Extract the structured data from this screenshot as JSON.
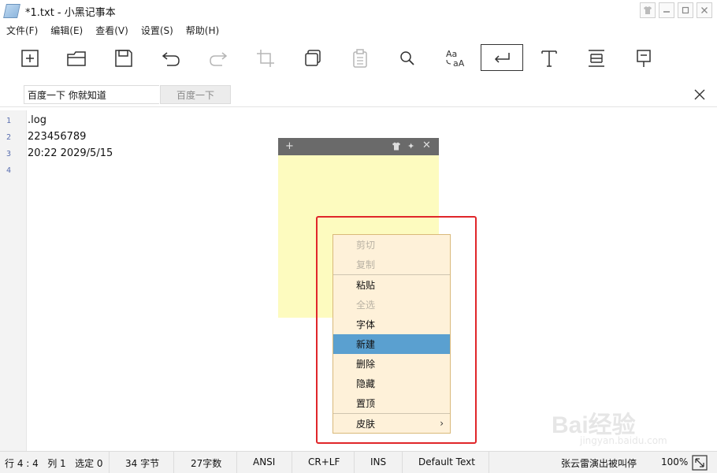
{
  "window": {
    "title": "*1.txt - 小黑记事本",
    "controls": [
      "shirt-icon",
      "minimize-icon",
      "maximize-icon",
      "close-icon"
    ]
  },
  "menu": [
    {
      "label": "文件(F)"
    },
    {
      "label": "编辑(E)"
    },
    {
      "label": "查看(V)"
    },
    {
      "label": "设置(S)"
    },
    {
      "label": "帮助(H)"
    }
  ],
  "search": {
    "value": "百度一下 你就知道",
    "button_label": "百度一下"
  },
  "editor": {
    "line_numbers": [
      "1",
      "2",
      "3",
      "4"
    ],
    "lines": [
      ".log",
      "223456789",
      "20:22 2029/5/15",
      ""
    ]
  },
  "note": {
    "add_glyph": "+",
    "pin_glyph": "✦",
    "close_glyph": "✕"
  },
  "context_menu": {
    "items": [
      {
        "label": "剪切",
        "state": "disabled"
      },
      {
        "label": "复制",
        "state": "disabled"
      },
      {
        "label": "粘贴",
        "state": "normal"
      },
      {
        "label": "全选",
        "state": "disabled"
      },
      {
        "label": "字体",
        "state": "normal"
      },
      {
        "label": "新建",
        "state": "selected"
      },
      {
        "label": "删除",
        "state": "normal"
      },
      {
        "label": "隐藏",
        "state": "normal"
      },
      {
        "label": "置顶",
        "state": "normal"
      },
      {
        "label": "皮肤",
        "state": "normal",
        "submenu": true
      }
    ],
    "submenu_glyph": "›"
  },
  "statusbar": {
    "position": "行 4 : 4   列 1   选定 0",
    "bytes": "34 字节",
    "chars": "27字数",
    "encoding": "ANSI",
    "line_ending": "CR+LF",
    "mode": "INS",
    "style": "Default Text",
    "marquee": "张云雷演出被叫停",
    "zoom": "100%"
  },
  "watermark": {
    "brand": "Bai经验",
    "url": "jingyan.baidu.com"
  },
  "colors": {
    "note_bg": "#fdfbbf",
    "note_header": "#6a6a6a",
    "menu_bg": "#fef1d9",
    "menu_selected": "#5aa0d0",
    "highlight_box": "#e0262a",
    "line_number": "#5a6fb0"
  }
}
